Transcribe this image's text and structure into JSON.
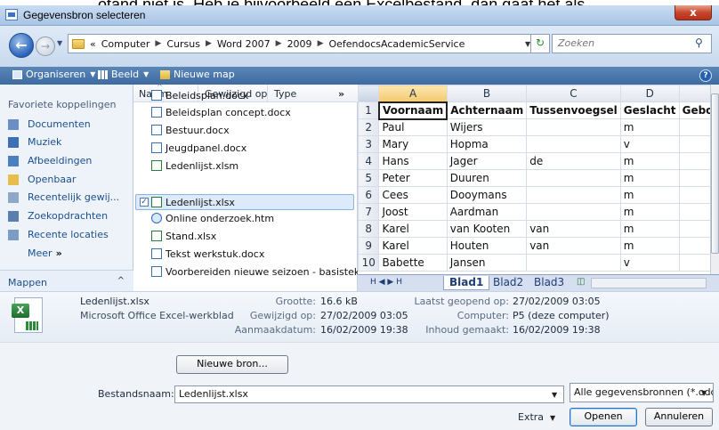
{
  "window": {
    "title": "Gegevensbron selecteren",
    "close_label": "x",
    "behind_text": "otand niet is. Heb je bijvoorbeeld een Excelbestand, dan gaat het als"
  },
  "address": {
    "prefix": "«",
    "path": [
      "Computer",
      "Cursus",
      "Word 2007",
      "2009",
      "OefendocsAcademicService"
    ],
    "search_placeholder": "Zoeken"
  },
  "toolbar": {
    "organize": "Organiseren",
    "view": "Beeld",
    "new_folder": "Nieuwe map"
  },
  "favorites": {
    "heading": "Favoriete koppelingen",
    "items": [
      "Documenten",
      "Muziek",
      "Afbeeldingen",
      "Openbaar",
      "Recentelijk gewij...",
      "Zoekopdrachten",
      "Recente locaties"
    ],
    "more": "Meer",
    "more_chevron": "»",
    "folders": "Mappen"
  },
  "filelist": {
    "columns": [
      "Naam",
      "Gewijzigd op",
      "Type"
    ],
    "more_cols": "»",
    "files": [
      {
        "name": "Beleidsplan.docx",
        "kind": "doc"
      },
      {
        "name": "Beleidsplan concept.docx",
        "kind": "doc"
      },
      {
        "name": "Bestuur.docx",
        "kind": "doc"
      },
      {
        "name": "Jeugdpanel.docx",
        "kind": "doc"
      },
      {
        "name": "Ledenlijst.xlsm",
        "kind": "xls"
      },
      {
        "name": "Ledenlijst.xlsx",
        "kind": "xls",
        "selected": true
      },
      {
        "name": "Online onderzoek.htm",
        "kind": "htm"
      },
      {
        "name": "Stand.xlsx",
        "kind": "xls"
      },
      {
        "name": "Tekst werkstuk.docx",
        "kind": "doc"
      },
      {
        "name": "Voorbereiden nieuwe seizoen - basistek...",
        "kind": "doc"
      }
    ]
  },
  "preview": {
    "col_letters": [
      "A",
      "B",
      "C",
      "D"
    ],
    "headers": [
      "Voornaam",
      "Achternaam",
      "Tussenvoegsel",
      "Geslacht",
      "Gebo"
    ],
    "rows": [
      [
        "Paul",
        "Wijers",
        "",
        "m"
      ],
      [
        "Mary",
        "Hopma",
        "",
        "v"
      ],
      [
        "Hans",
        "Jager",
        "de",
        "m"
      ],
      [
        "Peter",
        "Duuren",
        "",
        "m"
      ],
      [
        "Cees",
        "Dooymans",
        "",
        "m"
      ],
      [
        "Joost",
        "Aardman",
        "",
        "m"
      ],
      [
        "Karel",
        "van Kooten",
        "van",
        "m"
      ],
      [
        "Karel",
        "Houten",
        "van",
        "m"
      ],
      [
        "Babette",
        "Jansen",
        "",
        "v"
      ]
    ],
    "sheets": [
      "Blad1",
      "Blad2",
      "Blad3"
    ],
    "nav_glyphs": "H  ◀  ▶  H"
  },
  "details": {
    "filename": "Ledenlijst.xlsx",
    "filetype": "Microsoft Office Excel-werkblad",
    "size_label": "Grootte:",
    "size_value": "16.6 kB",
    "modified_label": "Gewijzigd op:",
    "modified_value": "27/02/2009 03:05",
    "created_label": "Aanmaakdatum:",
    "created_value": "16/02/2009 19:38",
    "opened_label": "Laatst geopend op:",
    "opened_value": "27/02/2009 03:05",
    "computer_label": "Computer:",
    "computer_value": "P5 (deze computer)",
    "content_label": "Inhoud gemaakt:",
    "content_value": "16/02/2009 19:38"
  },
  "bottom": {
    "new_source": "Nieuwe bron...",
    "filename_label": "Bestandsnaam:",
    "filename_value": "Ledenlijst.xlsx",
    "filter_value": "Alle gegevensbronnen (*.odc;",
    "extra": "Extra",
    "open": "Openen",
    "cancel": "Annuleren"
  },
  "colors": {
    "toolbar": "#3d6aa0",
    "selection": "#ddeaf9",
    "excel_green": "#2a7a3a",
    "link_blue": "#1b4f8e"
  }
}
